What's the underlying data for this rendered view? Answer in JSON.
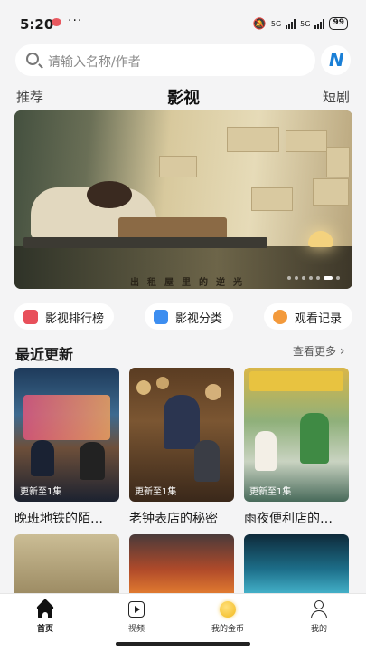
{
  "status_bar": {
    "time": "5:20",
    "network1": "5G",
    "network2": "5G",
    "battery": "99"
  },
  "search": {
    "placeholder": "请输入名称/作者"
  },
  "top_tabs": {
    "left": "推荐",
    "center": "影视",
    "right": "短剧"
  },
  "banner": {
    "caption": "出租屋里的逆光",
    "slides": 7,
    "active_slide": 6
  },
  "shortcuts": [
    {
      "label": "影视排行榜",
      "color": "#e8505b"
    },
    {
      "label": "影视分类",
      "color": "#3d8ef0"
    },
    {
      "label": "观看记录",
      "color": "#f39a3c"
    }
  ],
  "recent": {
    "title": "最近更新",
    "more": "查看更多",
    "items": [
      {
        "badge": "更新至1集",
        "title": "晚班地铁的陌…"
      },
      {
        "badge": "更新至1集",
        "title": "老钟表店的秘密"
      },
      {
        "badge": "更新至1集",
        "title": "雨夜便利店的…"
      }
    ]
  },
  "bottom_nav": [
    {
      "label": "首页"
    },
    {
      "label": "视频"
    },
    {
      "label": "我的金币"
    },
    {
      "label": "我的"
    }
  ]
}
